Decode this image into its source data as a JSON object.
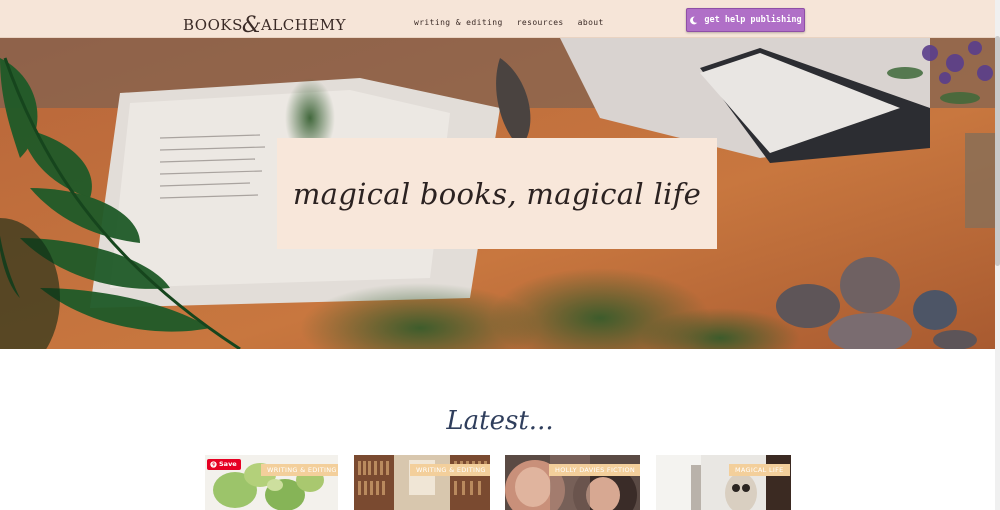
{
  "header": {
    "logo_part1": "BOOKS",
    "logo_amp": "&",
    "logo_part2": "ALCHEMY",
    "nav": [
      "writing & editing",
      "resources",
      "about"
    ],
    "cta_label": "get help publishing",
    "cta_icon": "moon-icon",
    "cta_color": "#b06fc7",
    "background": "#f6e5d8"
  },
  "hero": {
    "title": "magical books, magical life",
    "card_color": "#f8e7da"
  },
  "latest": {
    "heading": "Latest...",
    "save_label": "Save",
    "save_icon": "pinterest-icon",
    "cards": [
      {
        "tag": "WRITING & EDITING"
      },
      {
        "tag": "WRITING & EDITING"
      },
      {
        "tag": "HOLLY DAVIES FICTION"
      },
      {
        "tag": "MAGICAL LIFE"
      }
    ],
    "tag_color": "#f3cf9b",
    "heading_color": "#2f3e5c"
  }
}
